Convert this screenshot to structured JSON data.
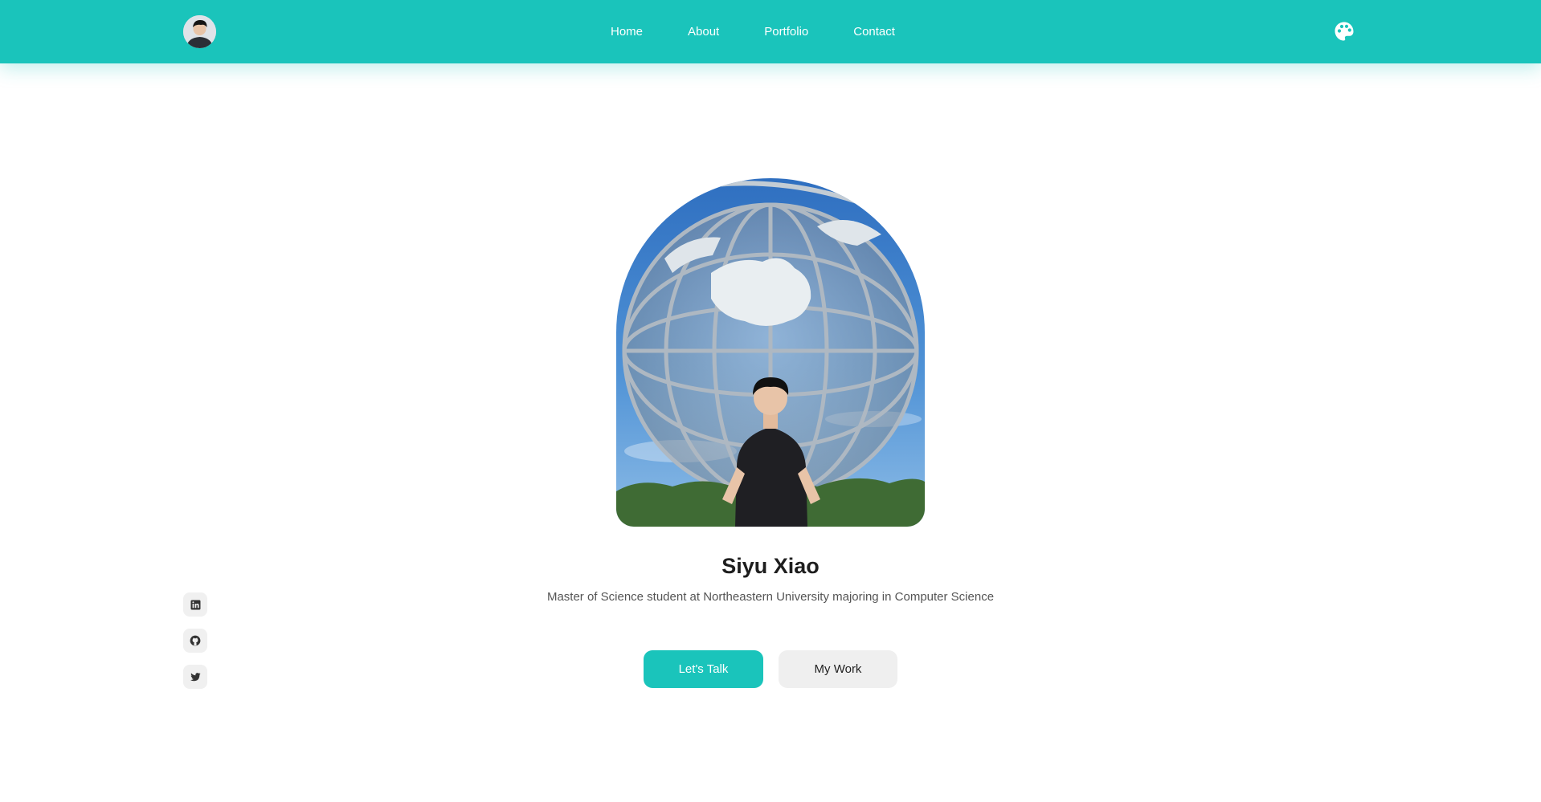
{
  "nav": {
    "links": [
      "Home",
      "About",
      "Portfolio",
      "Contact"
    ]
  },
  "hero": {
    "name": "Siyu Xiao",
    "description": "Master of Science student at Northeastern University majoring in Computer Science",
    "primary_button": "Let's Talk",
    "secondary_button": "My Work"
  },
  "social": {
    "icons": [
      "linkedin-icon",
      "github-icon",
      "twitter-icon"
    ]
  },
  "icons": {
    "theme": "palette-icon"
  },
  "colors": {
    "accent": "#1ac4bb",
    "sky": "#3f86cf",
    "secondary_button_bg": "#efefef",
    "text_dark": "#1e1e1e",
    "text_muted": "#555555"
  }
}
